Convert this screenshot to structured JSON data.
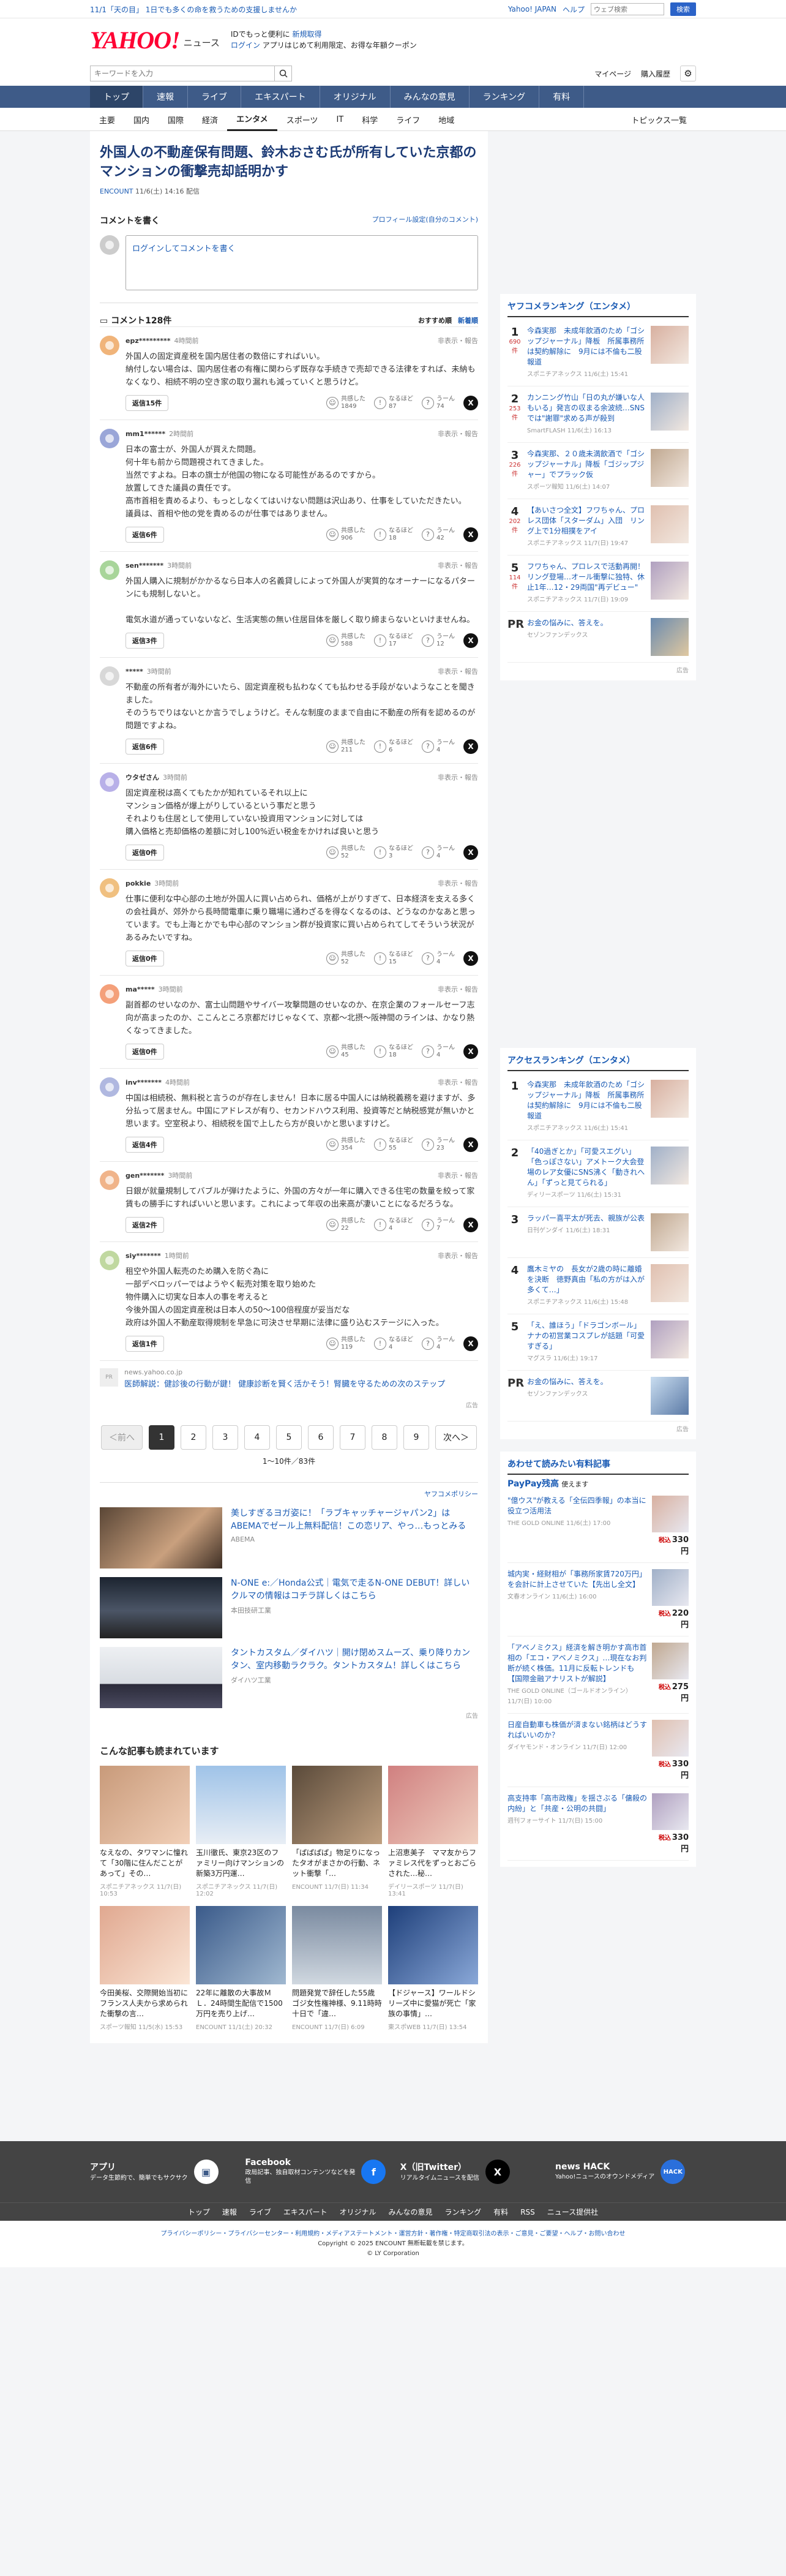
{
  "topnotice": {
    "left": "11/1「天の目」 1日でも多くの命を救うための支援しませんか",
    "links": [
      "Yahoo! JAPAN",
      "ヘルプ"
    ],
    "search_placeholder": "ウェブ検索",
    "search_button": "検索"
  },
  "masthead": {
    "logo": "YAHOO!",
    "logo_sub": "ニュース",
    "promo_line1_a": "IDでもっと便利に",
    "promo_line1_b": "新規取得",
    "promo_line2_a": "ログイン",
    "promo_line2_b": "アプリはじめて利用限定、お得な年額クーポン"
  },
  "searchrow": {
    "placeholder": "キーワードを入力",
    "links": [
      "マイページ",
      "購入履歴"
    ]
  },
  "mainnav": [
    "トップ",
    "速報",
    "ライブ",
    "エキスパート",
    "オリジナル",
    "みんなの意見",
    "ランキング",
    "有料"
  ],
  "subnav": [
    "主要",
    "国内",
    "国際",
    "経済",
    "エンタメ",
    "スポーツ",
    "IT",
    "科学",
    "ライフ",
    "地域"
  ],
  "subnav_right": "トピックス一覧",
  "article": {
    "title": "外国人の不動産保有問題、鈴木おさむ氏が所有していた京都のマンションの衝撃売却話明かす",
    "source": "ENCOUNT",
    "date": "11/6(土) 14:16 配信"
  },
  "comment_box": {
    "heading": "コメントを書く",
    "link": "プロフィール設定(自分のコメント)",
    "placeholder": "ログインしてコメントを書く"
  },
  "comments_head": {
    "count": "コメント128件",
    "sort_a": "おすすめ順",
    "sort_b": "新着順"
  },
  "report_label": "非表示・報告",
  "reaction_labels": [
    "共感した",
    "なるほど",
    "うーん"
  ],
  "comments": [
    {
      "user": "epz*********",
      "time": "4時間前",
      "text": "外国人の固定資産税を国内居住者の数倍にすればいい。\n納付しない場合は、国内居住者の有権に関わらず既存な手続きで売却できる法律をすれば、未納もなくなり、相続不明の空き家の取り漏れも減っていくと思うけど。",
      "reply": "返信15件",
      "r1": "1849",
      "r2": "87",
      "r3": "74"
    },
    {
      "user": "mm1******",
      "time": "2時間前",
      "text": "日本の富士が、外国人が買えた問題。\n何十年も前から問題視されてきました。\n当然ですよね。日本の旗士が他国の物になる可能性があるのですから。\n放置してきた議員の責任です。\n高市首相を責めるより、もっとしなくてはいけない問題は沢山あり、仕事をしていただきたい。\n議員は、首相や他の党を責めるのが仕事ではありません。",
      "reply": "返信6件",
      "r1": "906",
      "r2": "18",
      "r3": "42"
    },
    {
      "user": "sen*******",
      "time": "3時間前",
      "text": "外国人購入に規制がかかるなら日本人の名義貸しによって外国人が実質的なオーナーになるパターンにも規制しないと。\n\n電気水道が通っていないなど、生活実態の無い住居目体を厳しく取り締まらないといけませんね。",
      "reply": "返信3件",
      "r1": "588",
      "r2": "17",
      "r3": "12"
    },
    {
      "user": "*****",
      "time": "3時間前",
      "text": "不動産の所有者が海外にいたら、固定資産税も払わなくても払わせる手段がないようなことを聞きました。\nそのうちでりはないとか言うでしょうけど。そんな制度のままで自由に不動産の所有を認めるのが問題ですよね。",
      "reply": "返信6件",
      "r1": "211",
      "r2": "6",
      "r3": "4"
    },
    {
      "user": "ウタゼさん",
      "time": "3時間前",
      "text": "固定資産税は高くてもたかが知れているそれ以上に\nマンション価格が爆上がりしているという事だと思う\nそれよりも住居として使用していない投資用マンションに対しては\n購入価格と売却価格の差額に対し100%近い税金をかければ良いと思う",
      "reply": "返信0件",
      "r1": "52",
      "r2": "3",
      "r3": "4"
    },
    {
      "user": "pokkie",
      "time": "3時間前",
      "text": "仕事に便利な中心部の土地が外国人に買い占められ、価格が上がりすぎて、日本経済を支える多くの会社員が、郊外から長時間電車に乗り職場に通わざるを得なくなるのは、どうなのかなあと思っています。でも上海とかでも中心部のマンション群が投資家に買い占められてしてそういう状況があるみたいですね。",
      "reply": "返信0件",
      "r1": "52",
      "r2": "15",
      "r3": "4"
    },
    {
      "user": "ma*****",
      "time": "3時間前",
      "text": "副首都のせいなのか、富士山問題やサイバー攻撃問題のせいなのか、在京企業のフォールセーフ志向が高まったのか、ここんところ京都だけじゃなくて、京都〜北摂〜阪神間のラインは、かなり熱くなってきました。",
      "reply": "返信0件",
      "r1": "45",
      "r2": "18",
      "r3": "4"
    },
    {
      "user": "inv*******",
      "time": "4時間前",
      "text": "中国は相続税、無料税と言うのが存在しません！日本に居る中国人には納税義務を避けますが、多分払って居ません。中国にアドレスが有り、セカンドハウス利用、投資等だと納税感覚が無いかと思います。空室税より、相続税を国で上したら方が良いかと思いますけど。",
      "reply": "返信4件",
      "r1": "354",
      "r2": "55",
      "r3": "23"
    },
    {
      "user": "gen*******",
      "time": "3時間前",
      "text": "日銀が就量規制してバブルが弾けたように、外国の方々が一年に購入できる住宅の数量を絞って家賃もの勝手にすればいいと思います。これによって年収の出来高が凄いことになるだろうな。",
      "reply": "返信2件",
      "r1": "22",
      "r2": "4",
      "r3": "7"
    },
    {
      "user": "siy*******",
      "time": "1時間前",
      "text": "租空や外国人転売のため購入を防ぐ為に\n一部デベロッパーではようやく転売対策を取り始めた\n物件購入に切実な日本人の事を考えると\n今後外国人の固定資産税は日本人の50〜100倍程度が妥当だな\n政府は外国人不動産取得規制を早急に可決させ早期に法律に盛り込むステージに入った。",
      "reply": "返信1件",
      "r1": "119",
      "r2": "4",
      "r3": "4"
    }
  ],
  "ad_source": {
    "label": "PR",
    "src": "news.yahoo.co.jp",
    "text": "医師解説：健診後の行動が鍵！ 健康診断を賢く活かそう！腎臓を守るための次のステップ"
  },
  "ad_flag": "広告",
  "pager": {
    "prev": "＜前へ",
    "pages": [
      "1",
      "2",
      "3",
      "4",
      "5",
      "6",
      "7",
      "8",
      "9"
    ],
    "next": "次へ＞",
    "count": "1〜10件／83件"
  },
  "ads_policy": "ヤフコメポリシー",
  "ads": [
    {
      "title": "美しすぎるヨガ姿に！「ラブキャッチャージャパン2」はABEMAでゼール上無料配信！この恋リア、やっ…もっとみる",
      "sub": "ABEMA"
    },
    {
      "title": "N-ONE e:／Honda公式｜電気で走るN-ONE DEBUT！詳しいクルマの情報はコチラ詳しくはこちら",
      "sub": "本田技研工業"
    },
    {
      "title": "タントカスタム／ダイハツ｜開け閉めスムーズ、乗り降りカンタン、室内移動ラクラク。タントカスタム！詳しくはこちら",
      "sub": "ダイハツ工業"
    }
  ],
  "related": {
    "heading": "こんな記事も読まれています",
    "items": [
      {
        "t": "なえなの、タワマンに憧れて「30階に住んだことがあって」その…",
        "s": "スポニチアネックス 11/7(日) 10:53"
      },
      {
        "t": "玉川徹氏、東京23区のファミリー向けマンションの新築3万円運…",
        "s": "スポニチアネックス 11/7(日) 12:02"
      },
      {
        "t": "「ぱぱぱぱ」物足りになったタオがまさかの行動、ネット衝撃「…",
        "s": "ENCOUNT 11/7(日) 11:34"
      },
      {
        "t": "上沼恵美子　ママ友からファミレス代をずっとおごらされた…秘…",
        "s": "デイリースポーツ 11/7(日) 13:41"
      },
      {
        "t": "今田美桜、交際開始当初にフランス人夫から求められた衝撃の言…",
        "s": "スポーツ報知 11/5(水) 15:53"
      },
      {
        "t": "22年に離散の大事故ＭＬ．24時間生配信で1500万円を売り上げ…",
        "s": "ENCOUNT 11/1(土) 20:32"
      },
      {
        "t": "問題発覚で辞任した55歳ゴジ女性権神様、9.11時時十日で「違…",
        "s": "ENCOUNT 11/7(日) 6:09"
      },
      {
        "t": "【ドジャース】ワールドシリーズ中に愛猫が死亡「家族の事情」…",
        "s": "東スポWEB 11/7(日) 13:54"
      }
    ]
  },
  "ranking": {
    "heading": "ヤフコメランキング（エンタメ）",
    "items": [
      {
        "n": "1",
        "c": "690件",
        "t": "今森実那　未成年飲酒のため「ゴシップジャーナル」降板　所属事務所は契約解除に　9月には不倫も二股報道",
        "s": "スポニチアネックス 11/6(土) 15:41"
      },
      {
        "n": "2",
        "c": "253件",
        "t": "カンニング竹山「日の丸が嫌いな人もいる」発言の収まる余波続…SNSでは\"謝罪\"求める声が殺到",
        "s": "SmartFLASH 11/6(土) 16:13"
      },
      {
        "n": "3",
        "c": "226件",
        "t": "今森実那、２０歳未満飲酒で「ゴシップジャーナル」降板「ゴジップジャー」でプラック仮",
        "s": "スポーツ報知 11/6(土) 14:07"
      },
      {
        "n": "4",
        "c": "202件",
        "t": "【あいさつ全文】フワちゃん、プロレス団体「スターダム」入団　リング上で1分相撲をアイ",
        "s": "スポニチアネックス 11/7(日) 19:47"
      },
      {
        "n": "5",
        "c": "114件",
        "t": "フワちゃん、プロレスで活動再開！リング登場…オール衝撃に独特、休止1年…12・29両国\"再デビュー\"",
        "s": "スポニチアネックス 11/7(日) 19:09"
      }
    ],
    "pr_title": "お金の悩みに、答えを。",
    "pr_sub": "セゾンファンデックス"
  },
  "access": {
    "heading": "アクセスランキング（エンタメ）",
    "items": [
      {
        "n": "1",
        "t": "今森実那　未成年飲酒のため「ゴシップジャーナル」降板　所属事務所は契約解除に　9月には不倫も二股報道",
        "s": "スポニチアネックス 11/6(土) 15:41"
      },
      {
        "n": "2",
        "t": "「40過ぎとか」「可愛スエグい」「色っぽさない」アメトーク大会登場のレア女優にSNS沸く「動きれへん」「ずっと見てられる」",
        "s": "ディリースポーツ 11/6(土) 15:31"
      },
      {
        "n": "3",
        "t": "ラッパー喜平太が死去、親族が公表",
        "s": "日刊ゲンダイ 11/6(土) 18:31"
      },
      {
        "n": "4",
        "t": "鷹木ミヤの　長女が2歳の時に離婚を決断　徳野真由「私の方がは入が多くて…」",
        "s": "スポニチアネックス 11/6(土) 15:48"
      },
      {
        "n": "5",
        "t": "「え、誰ほう」「ドラゴンボール」ナナの初営業コスプレが話題「可愛すぎる」",
        "s": "マグスラ 11/6(土) 19:17"
      }
    ],
    "pr_title": "お金の悩みに、答えを。",
    "pr_sub": "セゾンファンデックス"
  },
  "paid": {
    "heading": "あわせて読みたい有料記事",
    "pay": "PayPay残高",
    "pay_sub": "使えます",
    "items": [
      {
        "t": "\"億ウス\"が教える「全伝四季報」の本当に役立つ活用法",
        "s": "THE GOLD ONLINE 11/6(土) 17:00",
        "p": "330"
      },
      {
        "t": "城内実・経財相が「事務所家賃720万円」を会計に計上させていた【先出し全文】",
        "s": "文春オンライン 11/6(土) 16:00",
        "p": "220"
      },
      {
        "t": "「アベノミクス」経済を解き明かす高市首相の「エコ・アベノミクス」…現在なお判断が続く株価。11月に反転トレンドも【国際金融アナリストが解説】",
        "s": "THE GOLD ONLINE（ゴールドオンライン） 11/7(日) 10:00",
        "p": "275"
      },
      {
        "t": "日産自動車も株価が済まない銘柄はどうすればいいのか？",
        "s": "ダイヤモンド・オンライン 11/7(日) 12:00",
        "p": "330"
      },
      {
        "t": "高支持率「高市政権」を揺さぶる「傭殺の内紛」と「共産・公明の共闘」",
        "s": "週刊フォーサイト 11/7(日) 15:00",
        "p": "330"
      }
    ],
    "price_prefix": "税込",
    "currency": "円"
  },
  "footer": {
    "blocks": [
      {
        "title": "アプリ",
        "desc": "データ生節約で、簡単でもサクサク"
      },
      {
        "title": "Facebook",
        "desc": "政局記事、独自取材コンテンツなどを発信"
      },
      {
        "title": "X（旧Twitter）",
        "desc": "リアルタイムニュースを配信"
      },
      {
        "title": "news HACK",
        "desc": "Yahoo!ニュースのオウンドメディア"
      }
    ],
    "nav": [
      "トップ",
      "速報",
      "ライブ",
      "エキスパート",
      "オリジナル",
      "みんなの意見",
      "ランキング",
      "有料",
      "RSS",
      "ニュース提供社"
    ],
    "legal": "プライバシーポリシー・プライバシーセンター・利用規約・メディアステートメント・運営方針・著作権・特定商取引法の表示・ご意見・ご要望・ヘルプ・お問い合わせ",
    "copy1": "Copyright © 2025 ENCOUNT 無断転載を禁じます。",
    "copy2": "© LY Corporation"
  },
  "colors": {
    "brand": "#ff0033",
    "nav": "#3e5b88",
    "link": "#1a5bb4"
  }
}
